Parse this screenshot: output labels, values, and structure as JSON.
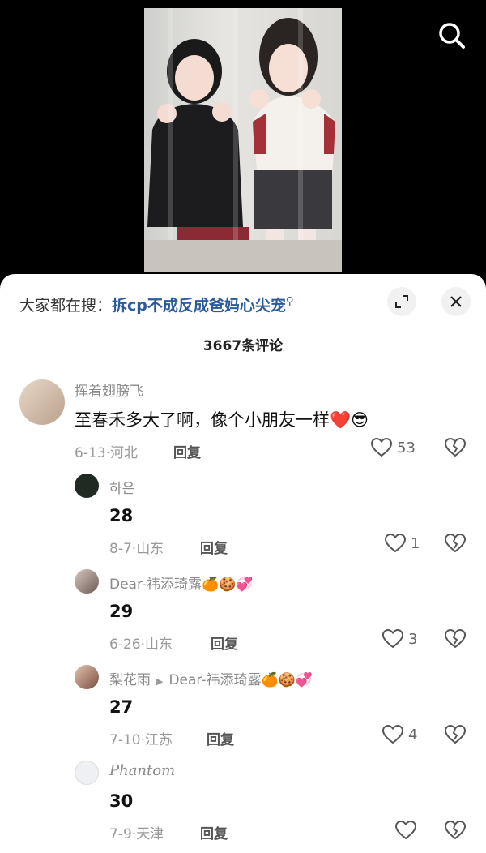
{
  "header": {
    "search_icon": "search-icon"
  },
  "search_bar": {
    "prefix": "大家都在搜：",
    "query": "拆cp不成反成爸妈心尖宠",
    "icon": "search-small-icon"
  },
  "comments_header": {
    "count": "3667条评论"
  },
  "comments": [
    {
      "user": "挥着翅膀飞",
      "text": "至春禾多大了啊，像个小朋友一样❤️😎",
      "date": "6-13",
      "region": "河北",
      "reply": "回复",
      "likes": "53"
    },
    {
      "user": "하은",
      "text": "28",
      "date": "8-7",
      "region": "山东",
      "reply": "回复",
      "likes": "1"
    },
    {
      "user": "Dear-祎添琦露🍊🍪💞",
      "text": "29",
      "date": "6-26",
      "region": "山东",
      "reply": "回复",
      "likes": "3"
    },
    {
      "user": "梨花雨",
      "reply_to": "Dear-祎添琦露🍊🍪💞",
      "text": "27",
      "date": "7-10",
      "region": "江苏",
      "reply": "回复",
      "likes": "4"
    },
    {
      "user": "Phantom",
      "text": "30",
      "date": "7-9",
      "region": "天津",
      "reply": "回复",
      "likes": ""
    }
  ],
  "colors": {
    "link": "#2b5b9a",
    "muted": "#999999",
    "sheet": "#ffffff"
  }
}
